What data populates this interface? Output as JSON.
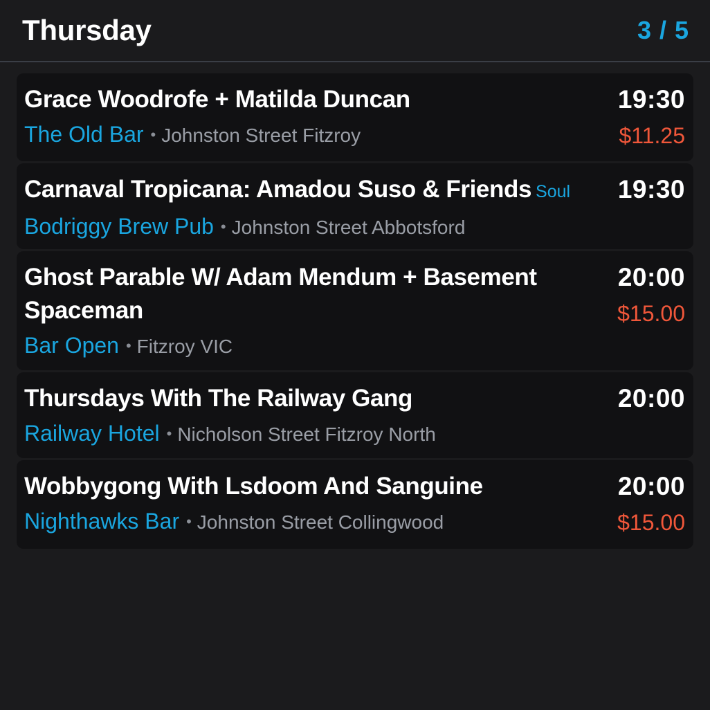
{
  "header": {
    "title": "Thursday",
    "pager": "3 / 5"
  },
  "events": [
    {
      "title": "Grace Woodrofe + Matilda Duncan",
      "genre": "",
      "venue": "The Old Bar",
      "separator": "•",
      "address": "Johnston Street Fitzroy",
      "time": "19:30",
      "price": "$11.25"
    },
    {
      "title": "Carnaval Tropicana: Amadou Suso & Friends",
      "genre": "Soul",
      "venue": "Bodriggy Brew Pub",
      "separator": "•",
      "address": "Johnston Street Abbotsford",
      "time": "19:30",
      "price": ""
    },
    {
      "title": "Ghost Parable W/ Adam Mendum + Basement Spaceman",
      "genre": "",
      "venue": "Bar Open",
      "separator": "•",
      "address": "Fitzroy VIC",
      "time": "20:00",
      "price": "$15.00"
    },
    {
      "title": "Thursdays With The Railway Gang",
      "genre": "",
      "venue": "Railway Hotel",
      "separator": "•",
      "address": "Nicholson Street Fitzroy North",
      "time": "20:00",
      "price": ""
    },
    {
      "title": "Wobbygong With Lsdoom And Sanguine",
      "genre": "",
      "venue": "Nighthawks Bar",
      "separator": "•",
      "address": "Johnston Street Collingwood",
      "time": "20:00",
      "price": "$15.00"
    }
  ],
  "colors": {
    "accent": "#1aa6e0",
    "price": "#f0573a",
    "background": "#1b1b1d",
    "card": "#111113"
  }
}
